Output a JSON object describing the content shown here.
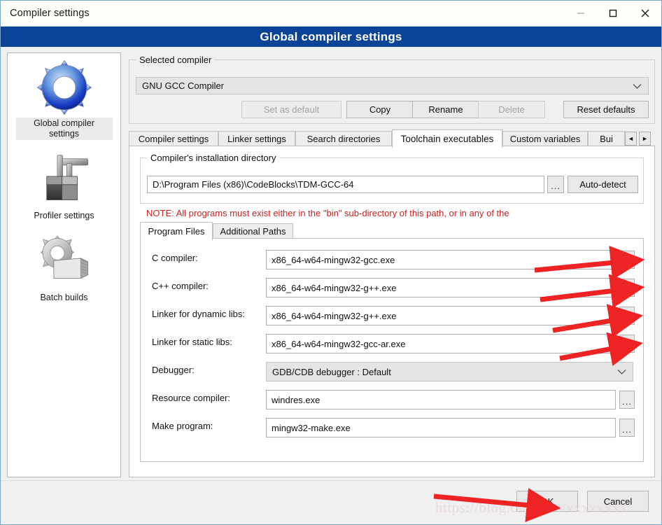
{
  "window": {
    "title": "Compiler settings",
    "banner": "Global compiler settings",
    "controls": {
      "minimize": "minimize-icon",
      "maximize": "maximize-icon",
      "close": "close-icon"
    }
  },
  "sidebar": {
    "items": [
      {
        "label": "Global compiler settings",
        "icon": "blue-gear-icon",
        "selected": true
      },
      {
        "label": "Profiler settings",
        "icon": "caliper-blocks-icon",
        "selected": false
      },
      {
        "label": "Batch builds",
        "icon": "gear-stack-icon",
        "selected": false
      }
    ]
  },
  "selected_compiler": {
    "group_title": "Selected compiler",
    "value": "GNU GCC Compiler",
    "buttons": [
      {
        "label": "Set as default",
        "disabled": true
      },
      {
        "label": "Copy",
        "disabled": false
      },
      {
        "label": "Rename",
        "disabled": false
      },
      {
        "label": "Delete",
        "disabled": true
      },
      {
        "label": "Reset defaults",
        "disabled": false
      }
    ]
  },
  "tabs": {
    "items": [
      {
        "label": "Compiler settings",
        "active": false
      },
      {
        "label": "Linker settings",
        "active": false
      },
      {
        "label": "Search directories",
        "active": false
      },
      {
        "label": "Toolchain executables",
        "active": true
      },
      {
        "label": "Custom variables",
        "active": false
      },
      {
        "label": "Bui",
        "active": false
      }
    ],
    "nav_prev": "◄",
    "nav_next": "►"
  },
  "install_dir": {
    "group_title": "Compiler's installation directory",
    "value": "D:\\Program Files (x86)\\CodeBlocks\\TDM-GCC-64",
    "browse_label": "...",
    "autodetect_label": "Auto-detect",
    "note": "NOTE: All programs must exist either in the \"bin\" sub-directory of this path, or in any of the",
    "note_color": "#cc2222"
  },
  "inner_tabs": {
    "items": [
      {
        "label": "Program Files",
        "active": true
      },
      {
        "label": "Additional Paths",
        "active": false
      }
    ]
  },
  "program_files": {
    "rows": [
      {
        "label": "C compiler:",
        "value": "x86_64-w64-mingw32-gcc.exe",
        "type": "text",
        "dots": true,
        "arrow": true
      },
      {
        "label": "C++ compiler:",
        "value": "x86_64-w64-mingw32-g++.exe",
        "type": "text",
        "dots": true,
        "arrow": true
      },
      {
        "label": "Linker for dynamic libs:",
        "value": "x86_64-w64-mingw32-g++.exe",
        "type": "text",
        "dots": true,
        "arrow": true
      },
      {
        "label": "Linker for static libs:",
        "value": "x86_64-w64-mingw32-gcc-ar.exe",
        "type": "text",
        "dots": true,
        "arrow": true
      },
      {
        "label": "Debugger:",
        "value": "GDB/CDB debugger : Default",
        "type": "combo",
        "dots": false,
        "arrow": false
      },
      {
        "label": "Resource compiler:",
        "value": "windres.exe",
        "type": "text",
        "dots": true,
        "arrow": false
      },
      {
        "label": "Make program:",
        "value": "mingw32-make.exe",
        "type": "text",
        "dots": true,
        "arrow": false
      }
    ],
    "dots_label": "..."
  },
  "footer": {
    "ok_label": "OK",
    "cancel_label": "Cancel"
  },
  "watermark": {
    "text": "https://blog.csdn.net/xxxxxxxx"
  },
  "colors": {
    "banner_blue": "#0b4396",
    "note_red": "#cc2222",
    "arrow_red": "#ee2323",
    "window_bg": "#f0f0f0"
  }
}
